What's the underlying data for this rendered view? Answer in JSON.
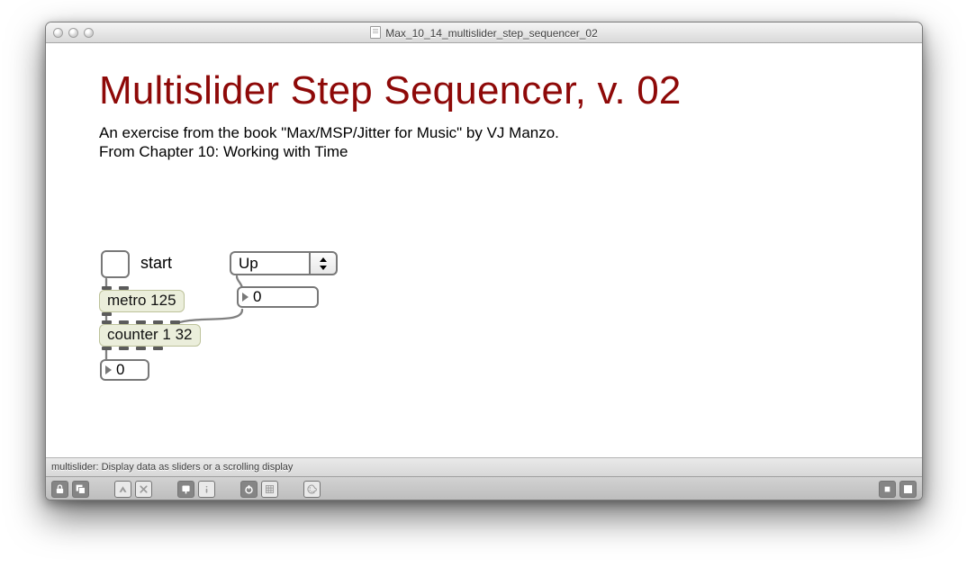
{
  "window": {
    "title": "Max_10_14_multislider_step_sequencer_02"
  },
  "header": {
    "title": "Multislider Step Sequencer, v. 02",
    "subtitle_line1": "An exercise from the book \"Max/MSP/Jitter for Music\" by VJ Manzo.",
    "subtitle_line2": "From Chapter 10: Working with Time"
  },
  "patch": {
    "toggle_label": "start",
    "metro_text": "metro 125",
    "counter_text": "counter 1 32",
    "number_out_value": "0",
    "umenu_value": "Up",
    "umenu_number_value": "0"
  },
  "status": {
    "hint": "multislider: Display data as sliders or a scrolling display"
  }
}
